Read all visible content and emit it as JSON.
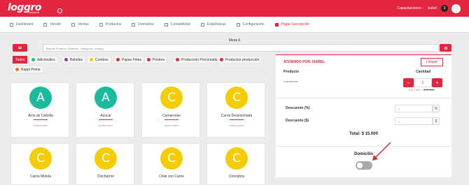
{
  "header": {
    "logo": "loggro",
    "logo_sub": "Restobar",
    "user_role": "Capacitaciones -",
    "user_name": "Isabel",
    "badge_count": "3"
  },
  "nav": [
    {
      "label": "Dashboard",
      "icon": "dashboard-icon"
    },
    {
      "label": "Vender",
      "icon": "cart-icon"
    },
    {
      "label": "Ventas",
      "icon": "tag-icon"
    },
    {
      "label": "Productos",
      "icon": "box-icon"
    },
    {
      "label": "Domicilios",
      "icon": "motorbike-icon"
    },
    {
      "label": "Contabilidad",
      "icon": "building-icon"
    },
    {
      "label": "Estadísticas",
      "icon": "chart-icon"
    },
    {
      "label": "Configuración",
      "icon": "gear-icon"
    },
    {
      "label": "Pagar Suscripción",
      "icon": "card-icon",
      "active": true
    }
  ],
  "mesa": "Mesa 6",
  "search": {
    "placeholder": "Buscar Producto (Nombre, Categoría, Código)"
  },
  "categories": [
    {
      "label": "Todos",
      "color": "#e3263f"
    },
    {
      "label": "Adicionales",
      "color": "#1abc9c"
    },
    {
      "label": "Bebidas",
      "color": "#7d3cbf"
    },
    {
      "label": "Combos",
      "color": "#f5cc00"
    },
    {
      "label": "Papas Fritas",
      "color": "#e3263f"
    },
    {
      "label": "Postres",
      "color": "#e3263f"
    },
    {
      "label": "Producción Porcionada",
      "color": "#e3263f"
    },
    {
      "label": "Productos producción",
      "color": "#e3263f"
    },
    {
      "label": "Rappi Prime",
      "color": "#f07020"
    }
  ],
  "products": [
    {
      "letter": "A",
      "name": "Aros de Cebolla",
      "category": "Adicionales",
      "color": "#1abc9c"
    },
    {
      "letter": "A",
      "name": "Azucar",
      "category": "Adicionales",
      "color": "#1abc9c"
    },
    {
      "letter": "C",
      "name": "Camarones",
      "category": "Adicionales",
      "color": "#f5cc00"
    },
    {
      "letter": "C",
      "name": "Carne Desmechada",
      "category": "Adicionales",
      "color": "#f5cc00"
    },
    {
      "letter": "C",
      "name": "Carne Molida",
      "category": "",
      "color": "#f5cc00"
    },
    {
      "letter": "C",
      "name": "Chicharrón",
      "category": "",
      "color": "#f5cc00"
    },
    {
      "letter": "C",
      "name": "Chile con Carne",
      "category": "",
      "color": "#f5cc00"
    },
    {
      "letter": "C",
      "name": "Chorizitos",
      "category": "",
      "color": "#f5cc00"
    }
  ],
  "order": {
    "attended_by": "ATENDIDO POR: ISABEL",
    "clear_label": "Limpiar",
    "col_product": "Producto",
    "col_qty": "Cantidad",
    "item_name": "Camarones",
    "item_qty": "1",
    "item_unit_price": "x $ 7.500 =",
    "item_total": "$ 15.000",
    "discount_pct_label": "Descuento (%)",
    "discount_pct_value": "0",
    "discount_amt_label": "Descuento ($)",
    "discount_amt_value": "0",
    "total": "Total: $ 15.000",
    "delivery_label": "Domicilio",
    "delivery_on": false
  },
  "colors": {
    "brand": "#e3263f"
  }
}
